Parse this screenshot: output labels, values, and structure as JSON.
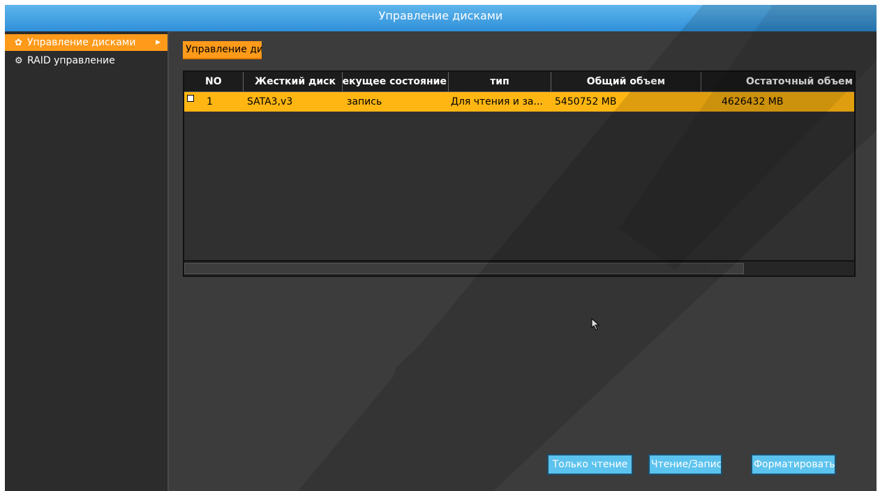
{
  "window": {
    "title": "Управление дисками"
  },
  "sidebar": {
    "items": [
      {
        "label": "Управление дисками",
        "icon": "gear-icon",
        "active": true
      },
      {
        "label": "RAID управление",
        "icon": "gears-icon",
        "active": false
      }
    ]
  },
  "main": {
    "section_tab": "Управление дисками",
    "table": {
      "columns": [
        "NO",
        "Жесткий диск",
        "Текущее состояние",
        "тип",
        "Общий объем",
        "Остаточный объем"
      ],
      "rows": [
        {
          "no": "1",
          "disk": "SATA3,v3",
          "state": "запись",
          "type": "Для чтения и за...",
          "total": "5450752 MB",
          "remaining": "4626432 MB"
        }
      ]
    },
    "buttons": {
      "readonly": "Только чтение",
      "readwrite": "Чтение/Запись",
      "format": "Форматировать"
    }
  },
  "colors": {
    "accent": "#ff9a1a",
    "selected_row": "#ffb612",
    "titlebar": "#3a9be0",
    "button": "#5cc3ee"
  }
}
